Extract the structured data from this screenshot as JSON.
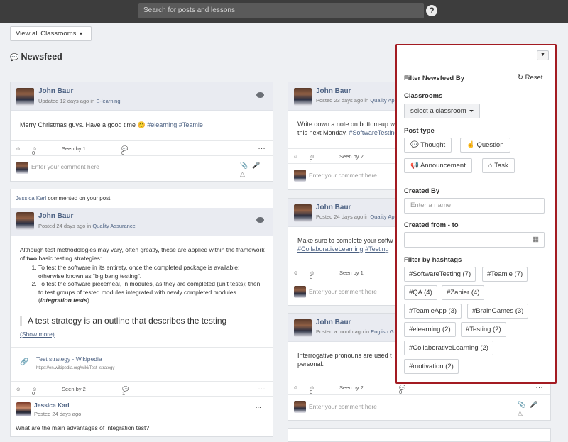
{
  "topbar": {
    "search_placeholder": "Search for posts and lessons",
    "help": "?"
  },
  "classroom_filter": "View all Classrooms",
  "newsfeed_title": "Newsfeed",
  "posts": [
    {
      "author": "John Baur",
      "meta_prefix": "Updated 12 days ago in ",
      "classroom": "E-learning",
      "text": "Merry Christmas guys. Have a good time 😊 ",
      "tags": [
        "#elearning",
        "#Teamie"
      ],
      "likes": "0",
      "seen": "Seen by 1",
      "comments": "0",
      "reply_placeholder": "Enter your comment here"
    },
    {
      "notification_user": "Jessica Karl",
      "notification_text": " commented on your post.",
      "author": "John Baur",
      "meta_prefix": "Posted 24 days ago in ",
      "classroom": "Quality Assurance",
      "intro": "Although test methodologies may vary, often greatly, these are applied within the framework of ",
      "intro_bold": "two",
      "intro_end": " basic testing strategies:",
      "li1": "To test the software in its entirety, once the completed package is available: otherwise known as “big bang testing”.",
      "li2_a": "To test the ",
      "li2_link": "software piecemeal",
      "li2_b": ", in modules, as they are completed (unit tests); then to test groups of tested modules integrated with newly completed modules (",
      "li2_em": "integration tests",
      "li2_c": ").",
      "quote": "A test strategy is an outline that describes the testing",
      "show_more": "(Show more)",
      "link_title": "Test strategy - Wikipedia",
      "link_url": "https://en.wikipedia.org/wiki/Test_strategy",
      "likes": "0",
      "seen": "Seen by 2",
      "comments": "1",
      "comment_author": "Jessica Karl",
      "comment_time": "Posted 24 days ago",
      "comment_text": "What are the main advantages of integration test?"
    },
    {
      "author": "John Baur",
      "meta_prefix": "Posted 23 days ago in ",
      "classroom": "Quality Ap",
      "text1": "Write down a note on bottom-up w",
      "text2": "this next Monday. ",
      "tag": "#SoftwareTesting",
      "likes": "0",
      "seen": "Seen by 2",
      "reply_placeholder": "Enter your comment here"
    },
    {
      "author": "John Baur",
      "meta_prefix": "Posted 24 days ago in ",
      "classroom": "Quality Ap",
      "text1": "Make sure to complete your softw",
      "tags": [
        "#CollaborativeLearning",
        "#Testing"
      ],
      "likes": "0",
      "seen": "Seen by 1",
      "reply_placeholder": "Enter your comment here"
    },
    {
      "author": "John Baur",
      "meta_prefix": "Posted a month ago in ",
      "classroom": "English G",
      "text1": "Interrogative pronouns are used t",
      "text2": "personal.",
      "likes": "0",
      "seen": "Seen by 2",
      "comments": "0",
      "reply_placeholder": "Enter your comment here"
    }
  ],
  "filter": {
    "title": "Filter Newsfeed By",
    "reset": "Reset",
    "toggle_icon": "filter-icon",
    "classrooms_label": "Classrooms",
    "classroom_select": "select a classroom",
    "post_type_label": "Post type",
    "post_types": [
      "Thought",
      "Question",
      "Announcement",
      "Task"
    ],
    "created_by_label": "Created By",
    "created_by_placeholder": "Enter a name",
    "created_range_label": "Created from - to",
    "hashtags_label": "Filter by hashtags",
    "hashtags": [
      "#SoftwareTesting (7)",
      "#Teamie (7)",
      "#QA (4)",
      "#Zapier (4)",
      "#TeamieApp (3)",
      "#BrainGames (3)",
      "#elearning (2)",
      "#Testing (2)",
      "#CollaborativeLearning (2)",
      "#motivation (2)"
    ]
  }
}
